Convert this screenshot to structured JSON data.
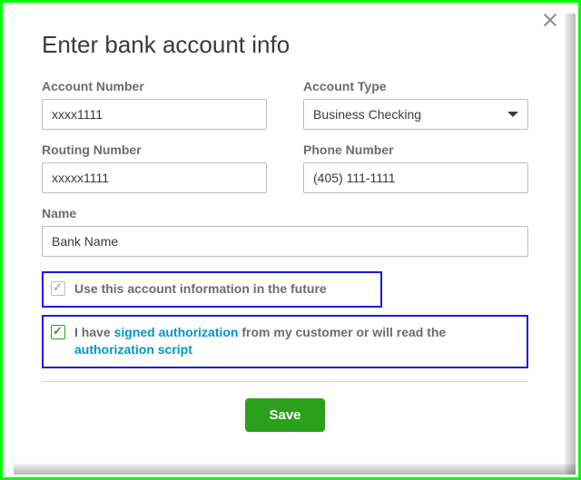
{
  "title": "Enter bank account info",
  "fields": {
    "accountNumber": {
      "label": "Account Number",
      "value": "xxxx1111"
    },
    "accountType": {
      "label": "Account Type",
      "value": "Business Checking"
    },
    "routingNumber": {
      "label": "Routing Number",
      "value": "xxxxx1111"
    },
    "phoneNumber": {
      "label": "Phone Number",
      "value": "(405) 111-1111"
    },
    "name": {
      "label": "Name",
      "value": "Bank Name"
    }
  },
  "checkboxes": {
    "useFuture": {
      "label": "Use this account information in the future",
      "checked": true
    },
    "authorization": {
      "prefix": "I have ",
      "link1": "signed authorization",
      "middle": " from my customer or will read the ",
      "link2": "authorization script",
      "checked": true
    }
  },
  "buttons": {
    "save": "Save"
  }
}
